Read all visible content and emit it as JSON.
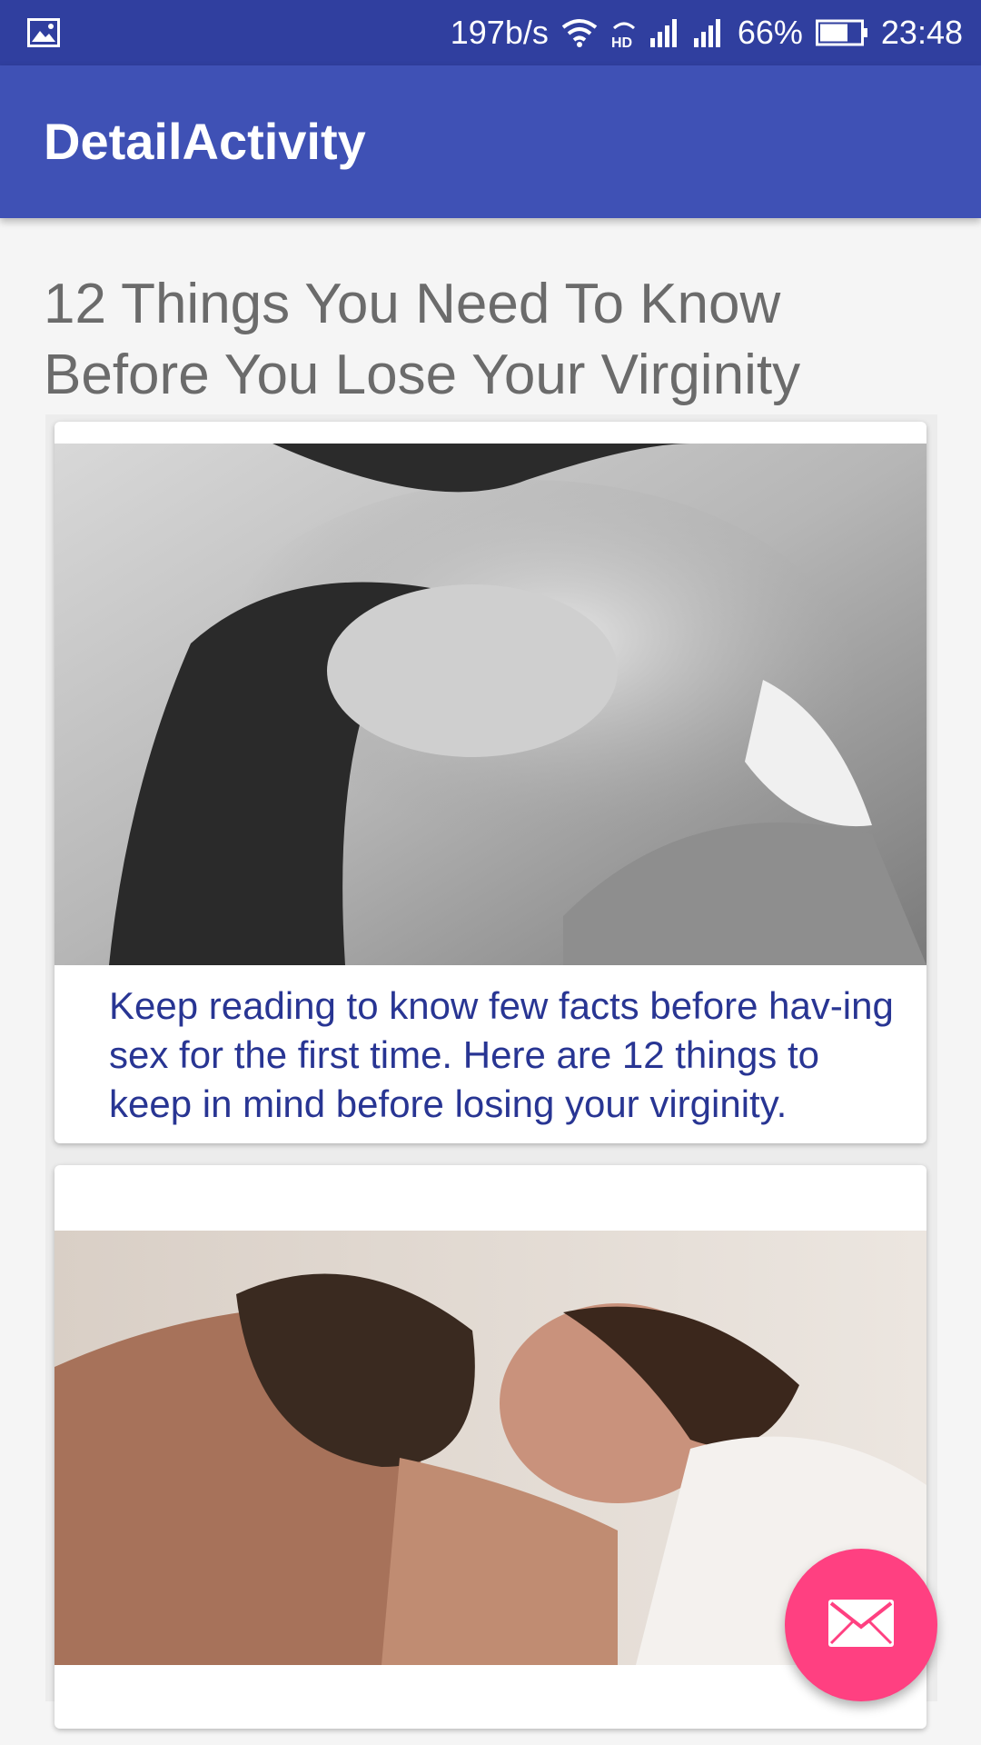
{
  "status_bar": {
    "speed": "197b/s",
    "battery": "66%",
    "time": "23:48",
    "icons": [
      "gallery-icon",
      "wifi-icon",
      "hd-icon",
      "signal-icon",
      "signal-icon",
      "battery-icon"
    ]
  },
  "app_bar": {
    "title": "DetailActivity"
  },
  "article": {
    "headline": "12 Things You Need To Know Before You Lose Your Virginity",
    "cards": [
      {
        "image": "couple-photo-grayscale",
        "text": "Keep reading to know few facts before hav-ing sex for the first time. Here are 12 things to keep in mind before losing your virginity."
      },
      {
        "image": "couple-photo-color"
      }
    ]
  },
  "fab": {
    "icon": "mail-icon"
  },
  "colors": {
    "status_bar": "#303f9f",
    "app_bar": "#3f51b5",
    "accent": "#ff4081",
    "card_text": "#283593"
  }
}
